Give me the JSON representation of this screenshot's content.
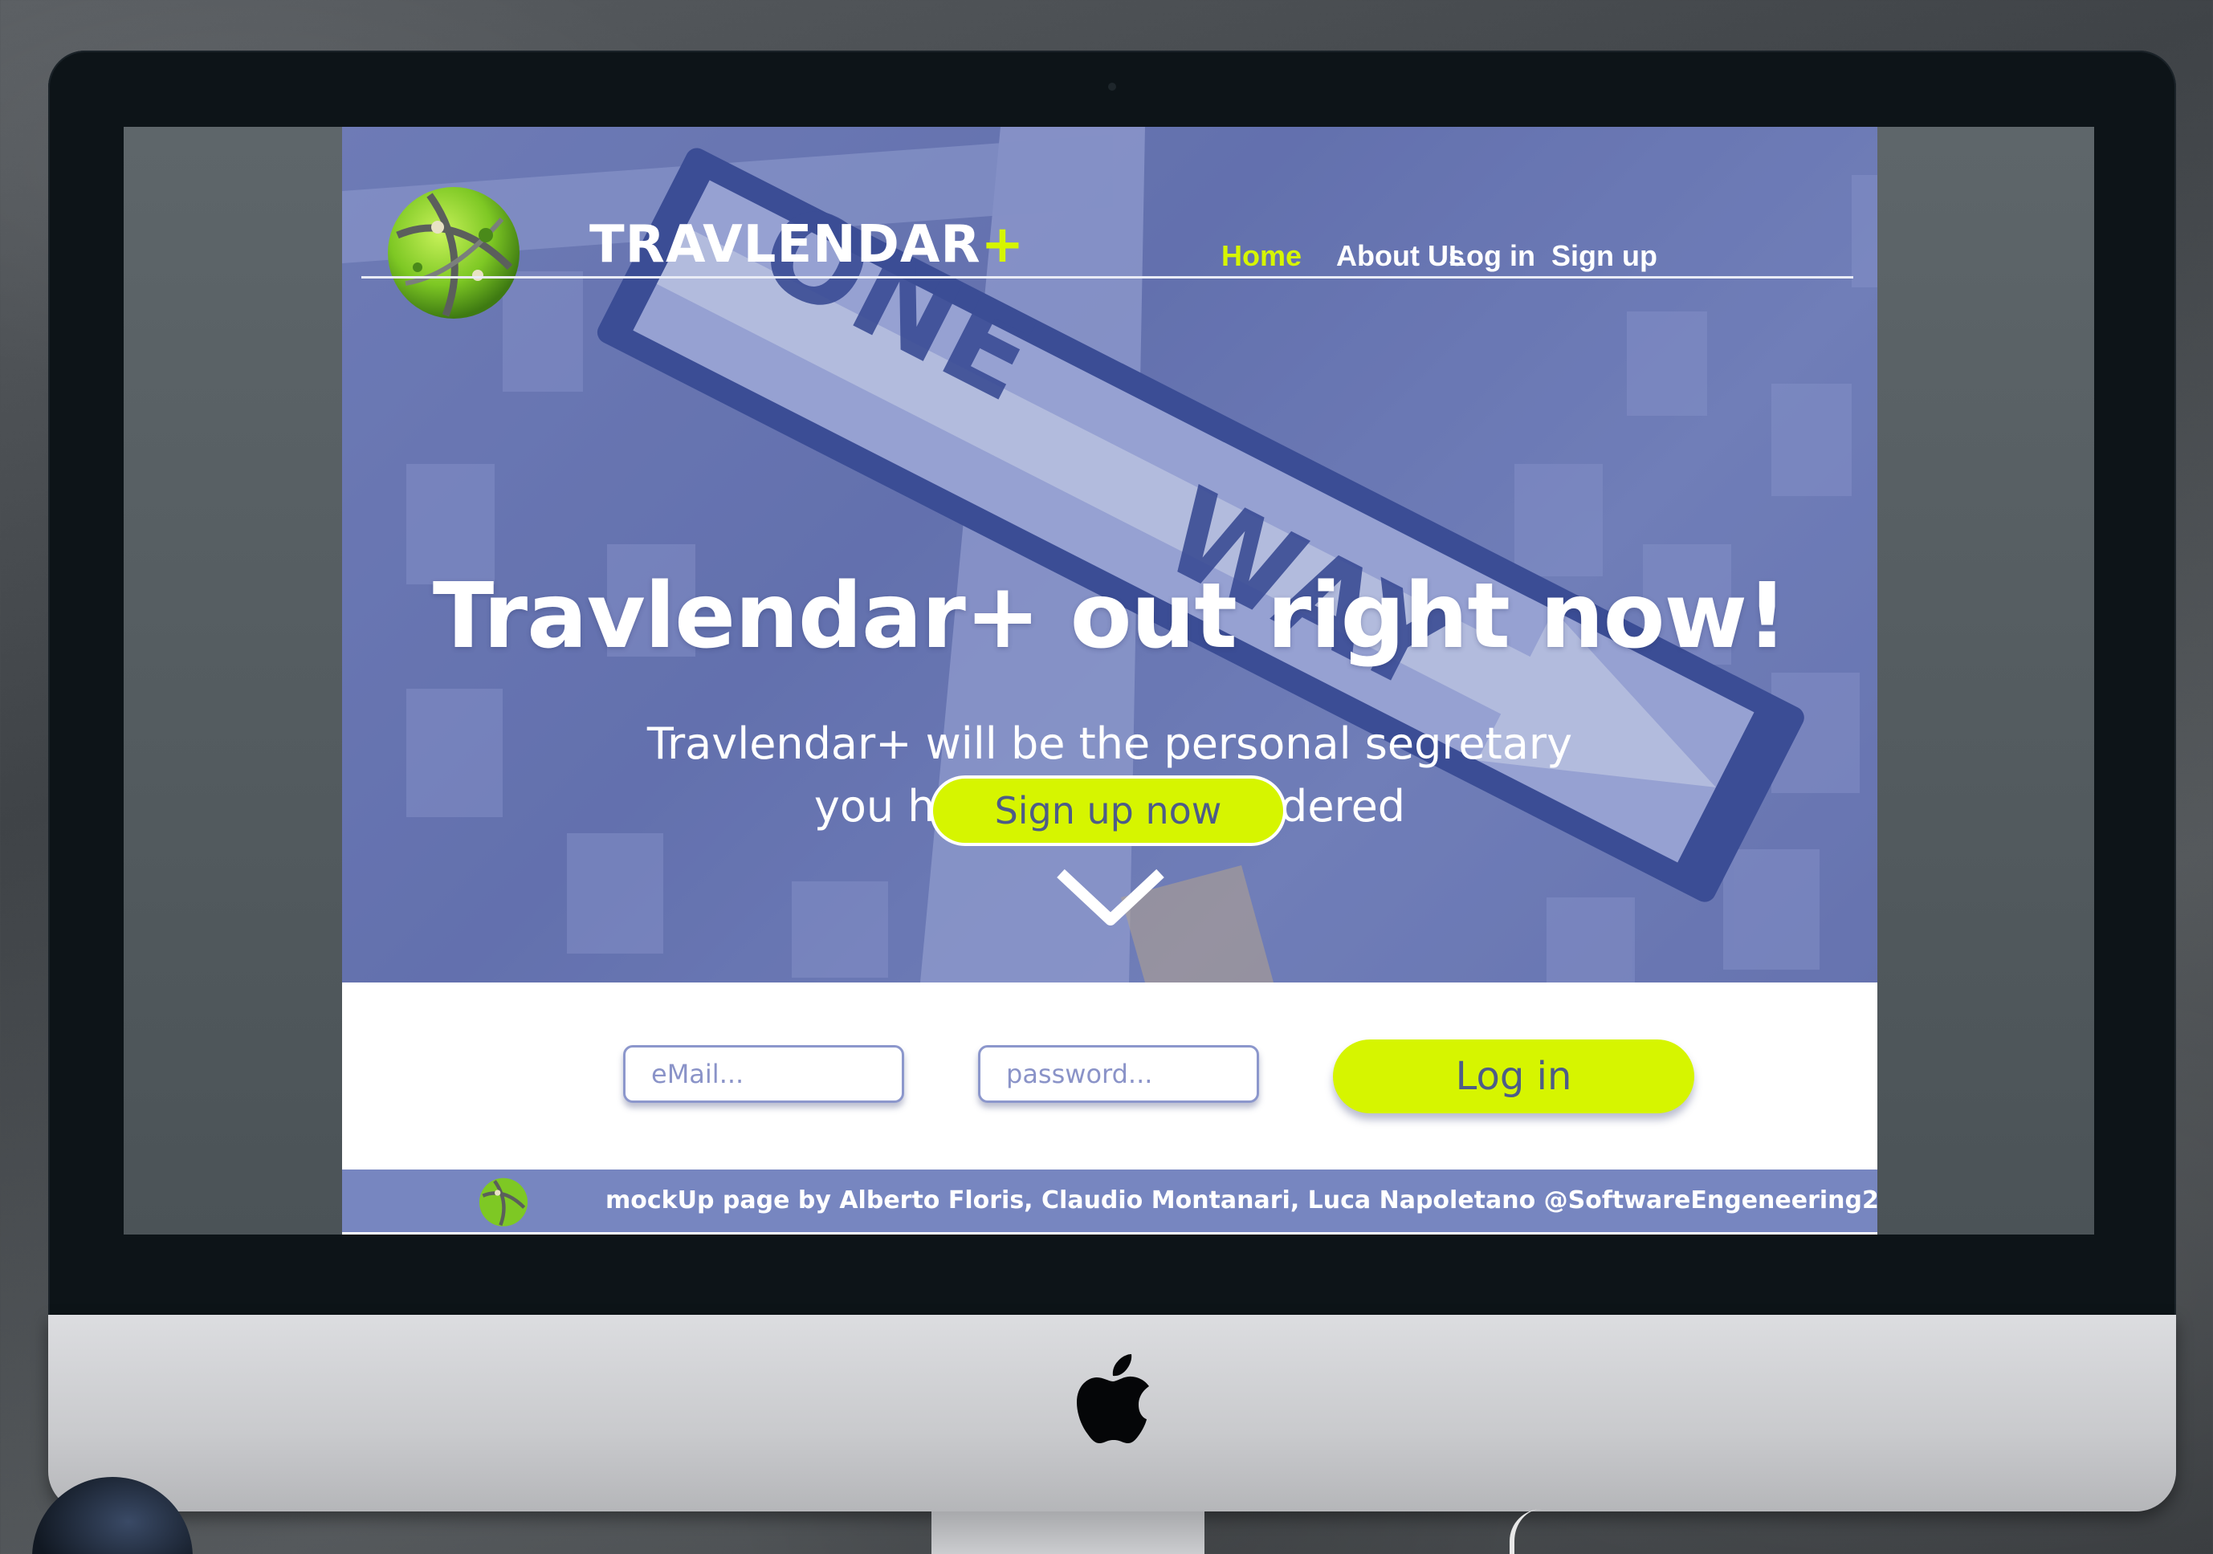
{
  "brand": {
    "name": "TRAVLENDAR",
    "plus": "+"
  },
  "nav": {
    "items": [
      {
        "label": "Home",
        "active": true
      },
      {
        "label": "About Us",
        "active": false
      },
      {
        "label": "Log in",
        "active": false
      },
      {
        "label": "Sign up",
        "active": false
      }
    ]
  },
  "hero": {
    "title": "Travlendar+ out right now!",
    "subtitle_line1": "Travlendar+ will be the personal  segretary",
    "subtitle_line2": "you have always wandered",
    "cta_label": "Sign up now",
    "scroll_icon": "chevron-down-icon",
    "background_sign_text": "ONE WAY"
  },
  "login": {
    "email_placeholder": "eMail...",
    "password_placeholder": "password...",
    "button_label": "Log in"
  },
  "footer": {
    "text": "mockUp page by Alberto Floris, Claudio Montanari, Luca Napoletano @SoftwareEngeneering2"
  },
  "colors": {
    "accent": "#d6f500",
    "hero_overlay": "#6a76ac",
    "footer_bg": "#7786c0",
    "button_text": "#4d5c88",
    "field_border": "#8c97cc"
  }
}
